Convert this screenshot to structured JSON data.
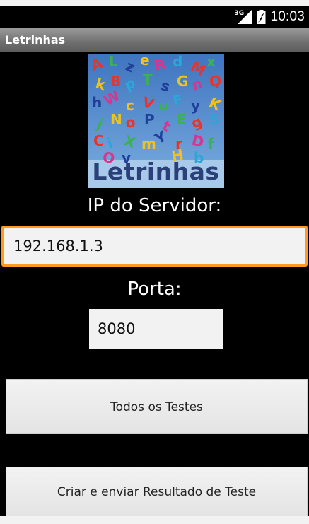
{
  "status_bar": {
    "network": "3G",
    "time": "10:03",
    "icons": [
      "signal-icon",
      "battery-icon"
    ]
  },
  "app": {
    "title": "Letrinhas"
  },
  "logo": {
    "word": "Letrinhas",
    "colors": {
      "background": "#4f86c6",
      "text": "#2b3f78"
    }
  },
  "form": {
    "ip_label": "IP do Servidor:",
    "ip_value": "192.168.1.3",
    "port_label": "Porta:",
    "port_value": "8080"
  },
  "buttons": {
    "all_tests": "Todos os Testes",
    "create_send": "Criar e enviar Resultado de Teste"
  },
  "colors": {
    "focus_border": "#ff9a1e",
    "background": "#000000",
    "field_bg": "#f2f2f2"
  }
}
